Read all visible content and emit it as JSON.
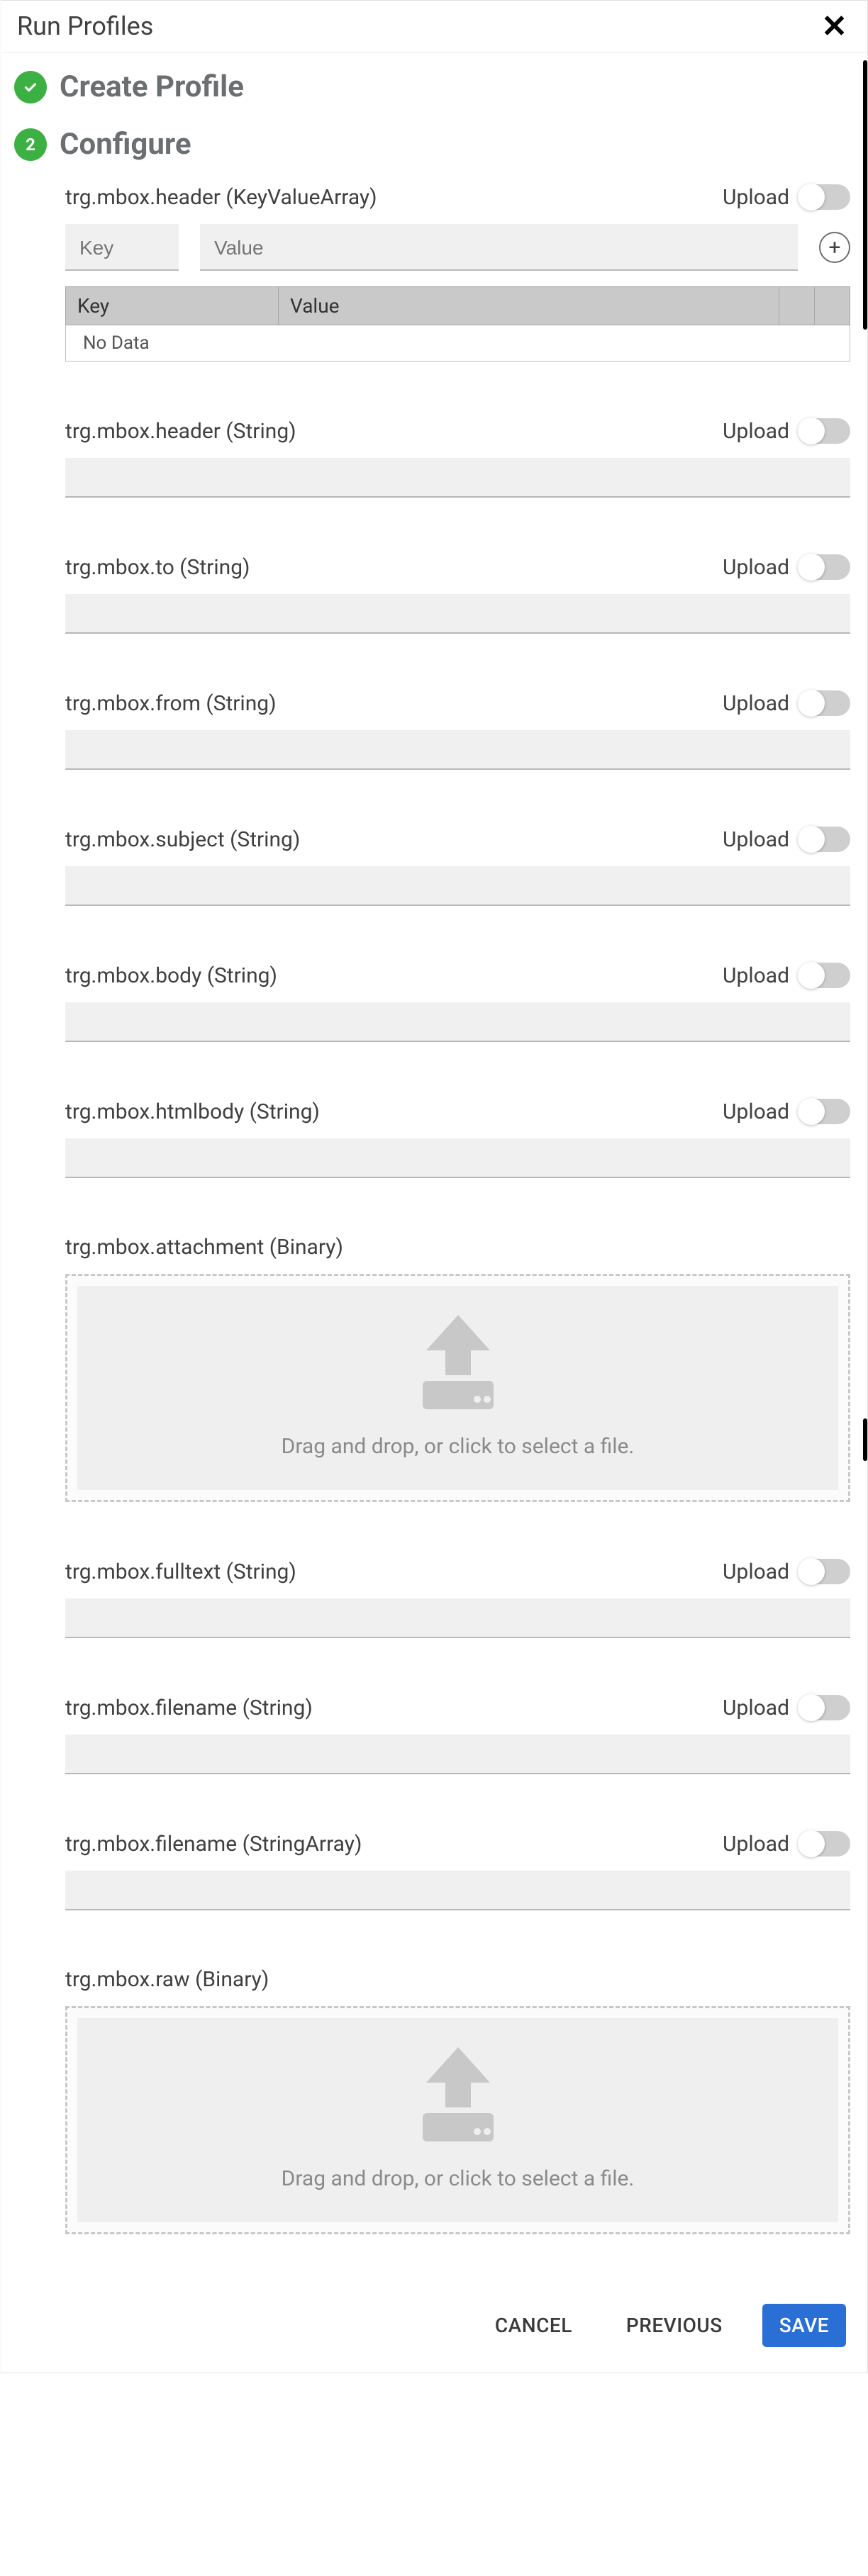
{
  "header": {
    "title": "Run Profiles"
  },
  "steps": [
    {
      "kind": "check",
      "label": "Create Profile"
    },
    {
      "kind": "number",
      "number": "2",
      "label": "Configure"
    }
  ],
  "upload_label": "Upload",
  "kv": {
    "key_placeholder": "Key",
    "value_placeholder": "Value",
    "table": {
      "col_key": "Key",
      "col_value": "Value",
      "no_data": "No Data"
    }
  },
  "dropzone_text": "Drag and drop, or click to select a file.",
  "fields": [
    {
      "label": "trg.mbox.header (KeyValueArray)",
      "type": "keyvalue"
    },
    {
      "label": "trg.mbox.header (String)",
      "type": "string"
    },
    {
      "label": "trg.mbox.to (String)",
      "type": "string"
    },
    {
      "label": "trg.mbox.from (String)",
      "type": "string"
    },
    {
      "label": "trg.mbox.subject (String)",
      "type": "string"
    },
    {
      "label": "trg.mbox.body (String)",
      "type": "string"
    },
    {
      "label": "trg.mbox.htmlbody (String)",
      "type": "string"
    },
    {
      "label": "trg.mbox.attachment (Binary)",
      "type": "binary"
    },
    {
      "label": "trg.mbox.fulltext (String)",
      "type": "string"
    },
    {
      "label": "trg.mbox.filename (String)",
      "type": "string"
    },
    {
      "label": "trg.mbox.filename (StringArray)",
      "type": "string"
    },
    {
      "label": "trg.mbox.raw (Binary)",
      "type": "binary"
    }
  ],
  "footer": {
    "cancel": "CANCEL",
    "previous": "PREVIOUS",
    "save": "SAVE"
  }
}
